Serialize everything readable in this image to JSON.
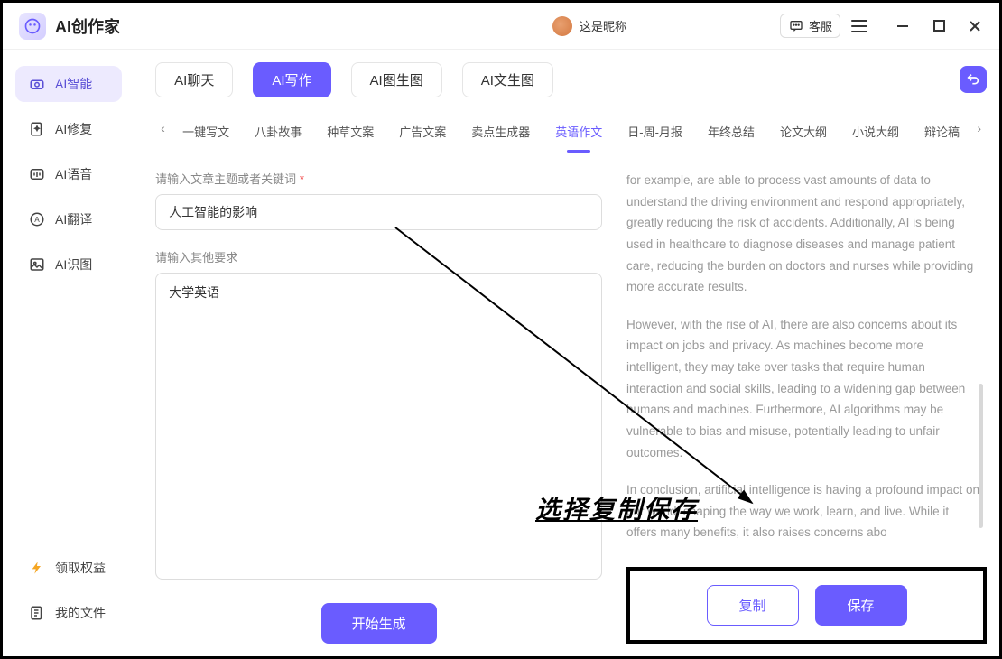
{
  "app": {
    "title": "AI创作家"
  },
  "user": {
    "nickname": "这是昵称"
  },
  "header": {
    "kefu": "客服"
  },
  "sidebar": {
    "items": [
      {
        "label": "AI智能",
        "icon": "camera"
      },
      {
        "label": "AI修复",
        "icon": "sparkle-doc"
      },
      {
        "label": "AI语音",
        "icon": "waveform"
      },
      {
        "label": "AI翻译",
        "icon": "translate"
      },
      {
        "label": "AI识图",
        "icon": "image"
      }
    ],
    "footer": [
      {
        "label": "领取权益",
        "icon": "bolt"
      },
      {
        "label": "我的文件",
        "icon": "folder"
      }
    ]
  },
  "modes": {
    "tabs": [
      "AI聊天",
      "AI写作",
      "AI图生图",
      "AI文生图"
    ],
    "active_index": 1
  },
  "subtabs": {
    "items": [
      "一键写文",
      "八卦故事",
      "种草文案",
      "广告文案",
      "卖点生成器",
      "英语作文",
      "日-周-月报",
      "年终总结",
      "论文大纲",
      "小说大纲",
      "辩论稿"
    ],
    "active_index": 5
  },
  "form": {
    "topic_label": "请输入文章主题或者关键词",
    "topic_value": "人工智能的影响",
    "other_label": "请输入其他要求",
    "other_value": "大学英语",
    "generate": "开始生成"
  },
  "output": {
    "p1": "for example, are able to process vast amounts of data to understand the driving environment and respond appropriately, greatly reducing the risk of accidents. Additionally, AI is being used in healthcare to diagnose diseases and manage patient care, reducing the burden on doctors and nurses while providing more accurate results.",
    "p2": "However, with the rise of AI, there are also concerns about its impact on jobs and privacy. As machines become more intelligent, they may take over tasks that require human interaction and social skills, leading to a widening gap between humans and machines. Furthermore, AI algorithms may be vulnerable to bias and misuse, potentially leading to unfair outcomes.",
    "p3": "In conclusion, artificial intelligence is having a profound impact on our world, shaping the way we work, learn, and live. While it offers many benefits, it also raises concerns abo"
  },
  "actions": {
    "copy": "复制",
    "save": "保存"
  },
  "annotation": {
    "text": "选择复制保存"
  }
}
